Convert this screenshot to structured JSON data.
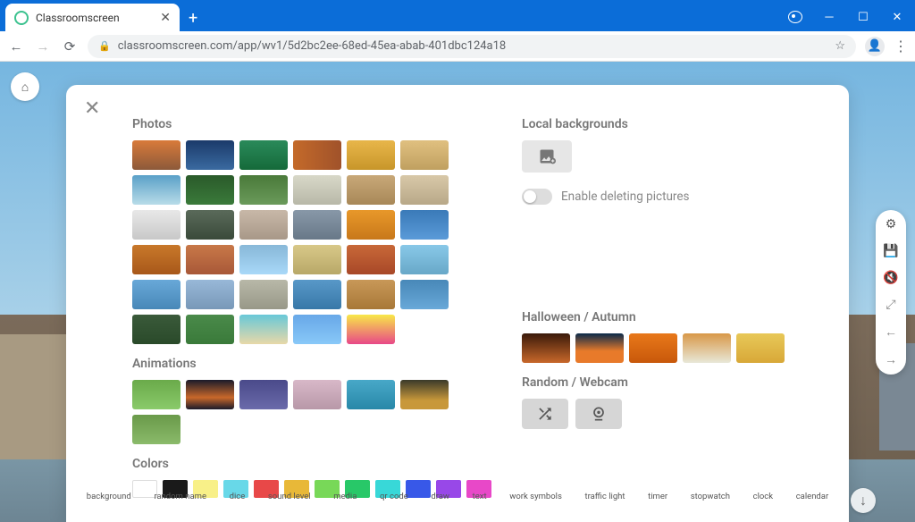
{
  "browser": {
    "tab_title": "Classroomscreen",
    "url": "classroomscreen.com/app/wv1/5d2bc2ee-68ed-45ea-abab-401dbc124a18"
  },
  "modal": {
    "photos_label": "Photos",
    "animations_label": "Animations",
    "colors_label": "Colors",
    "local_label": "Local backgrounds",
    "toggle_label": "Enable deleting pictures",
    "halloween_label": "Halloween / Autumn",
    "random_label": "Random / Webcam",
    "photo_thumbs": [
      "linear-gradient(to bottom,#d97b3a,#8c5a3a)",
      "linear-gradient(to bottom,#1b3a6a,#3a6aa0)",
      "linear-gradient(to bottom,#2a8a5a,#156a3a)",
      "linear-gradient(to right,#c46a2a,#a0522a)",
      "linear-gradient(#e8b64a,#c8962a)",
      "linear-gradient(#e0c080,#c0a060)",
      "linear-gradient(#5aa0c8,#b8dce8)",
      "linear-gradient(#2a5a2a,#3a7a3a)",
      "linear-gradient(#4a7a3a,#6a9a5a)",
      "linear-gradient(#d8d8c8,#b8b8a8)",
      "linear-gradient(#c8a878,#a88858)",
      "linear-gradient(#d8c8a8,#b8a888)",
      "linear-gradient(#e8e8e8,#c8c8c8)",
      "linear-gradient(#5a6a5a,#3a4a3a)",
      "linear-gradient(#c8b8a8,#a89888)",
      "linear-gradient(#8898a8,#687888)",
      "linear-gradient(#e8982a,#c8781a)",
      "linear-gradient(#3a7ab8,#5a9ad8)",
      "linear-gradient(#c8782a,#a8581a)",
      "linear-gradient(#c87848,#a85838)",
      "linear-gradient(#88b8d8,#a8d8f8)",
      "linear-gradient(#d8c888,#b8a868)",
      "linear-gradient(#c86838,#a84828)",
      "linear-gradient(#88c8e8,#68a8c8)",
      "linear-gradient(#68a8d8,#4888b8)",
      "linear-gradient(#98b8d8,#7898b8)",
      "linear-gradient(#b8b8a8,#989888)",
      "linear-gradient(#5898c8,#3878a8)",
      "linear-gradient(#c89858,#a87838)",
      "linear-gradient(#4888b8,#68a8d8)",
      "linear-gradient(#3a5a3a,#2a4a2a)",
      "linear-gradient(#4a8a4a,#3a7a3a)",
      "linear-gradient(#68c8d8,#e8d8a8)",
      "linear-gradient(#68a8e8,#88c8f8)",
      "linear-gradient(#f8e848,#e84888)"
    ],
    "animation_thumbs": [
      "linear-gradient(#6aaa4a,#8aca6a)",
      "linear-gradient(#1a1a2a,#c8682a 60%,#1a1a2a)",
      "linear-gradient(#4a4a8a,#6a6aaa)",
      "linear-gradient(#d8b8c8,#b898a8)",
      "linear-gradient(#48a8c8,#2888a8)",
      "linear-gradient(#3a3a2a,#c8983a 70%)",
      "linear-gradient(#6a9a4a,#8aba6a)"
    ],
    "halloween_thumbs": [
      "linear-gradient(#3a1a0a,#c8682a)",
      "linear-gradient(#0a2a4a,#e87a2a 60%)",
      "linear-gradient(#e8781a,#c8580a)",
      "linear-gradient(#d89848,#e8e8d8)",
      "linear-gradient(#e8c858,#d8a838)"
    ],
    "colors": [
      "#ffffff",
      "#1a1a1a",
      "#f8f088",
      "#68d8e8",
      "#e84848",
      "#e8b838",
      "#78d858",
      "#28c868",
      "#38d8d8",
      "#3858e8",
      "#9848e8",
      "#e848c8"
    ]
  },
  "widget_bar": [
    "background",
    "random name",
    "dice",
    "sound level",
    "media",
    "qr code",
    "draw",
    "text",
    "work symbols",
    "traffic light",
    "timer",
    "stopwatch",
    "clock",
    "calendar"
  ]
}
